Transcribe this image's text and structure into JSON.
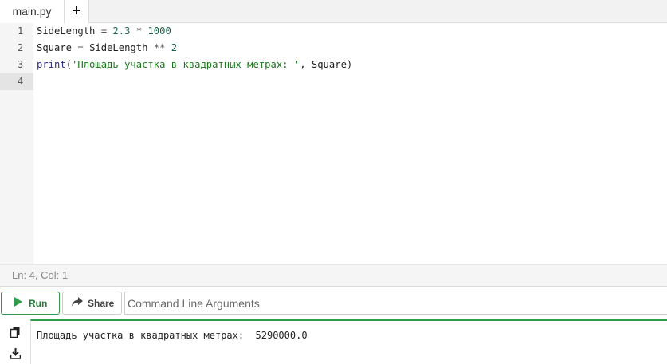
{
  "tabs": {
    "active_label": "main.py",
    "add_label": "+"
  },
  "editor": {
    "line_numbers": [
      "1",
      "2",
      "3",
      "4"
    ],
    "lines": [
      {
        "tokens": [
          {
            "text": "SideLength ",
            "kind": "id"
          },
          {
            "text": "= ",
            "kind": "op"
          },
          {
            "text": "2.3 ",
            "kind": "num"
          },
          {
            "text": "* ",
            "kind": "op"
          },
          {
            "text": "1000",
            "kind": "num"
          }
        ]
      },
      {
        "tokens": [
          {
            "text": "Square ",
            "kind": "id"
          },
          {
            "text": "= ",
            "kind": "op"
          },
          {
            "text": "SideLength ",
            "kind": "id"
          },
          {
            "text": "** ",
            "kind": "op"
          },
          {
            "text": "2",
            "kind": "num"
          }
        ]
      },
      {
        "tokens": [
          {
            "text": "print",
            "kind": "kw"
          },
          {
            "text": "(",
            "kind": "id"
          },
          {
            "text": "'Площадь участка в квадратных метрах: '",
            "kind": "str"
          },
          {
            "text": ", Square)",
            "kind": "id"
          }
        ]
      },
      {
        "tokens": []
      }
    ]
  },
  "status": {
    "text": "Ln: 4,  Col: 1"
  },
  "toolbar": {
    "run_label": "Run",
    "share_label": "Share",
    "args_placeholder": "Command Line Arguments",
    "args_value": ""
  },
  "output": {
    "text": "Площадь участка в квадратных метрах:  5290000.0"
  },
  "colors": {
    "accent_green": "#2e9a4a",
    "gutter_bg": "#f5f5f5",
    "string": "#1a7a1a",
    "number": "#116644",
    "keyword": "#2a2a8a"
  },
  "icons": {
    "add_tab": "plus-icon",
    "run": "play-icon",
    "share": "share-icon",
    "copy": "copy-icon",
    "download": "download-icon"
  }
}
